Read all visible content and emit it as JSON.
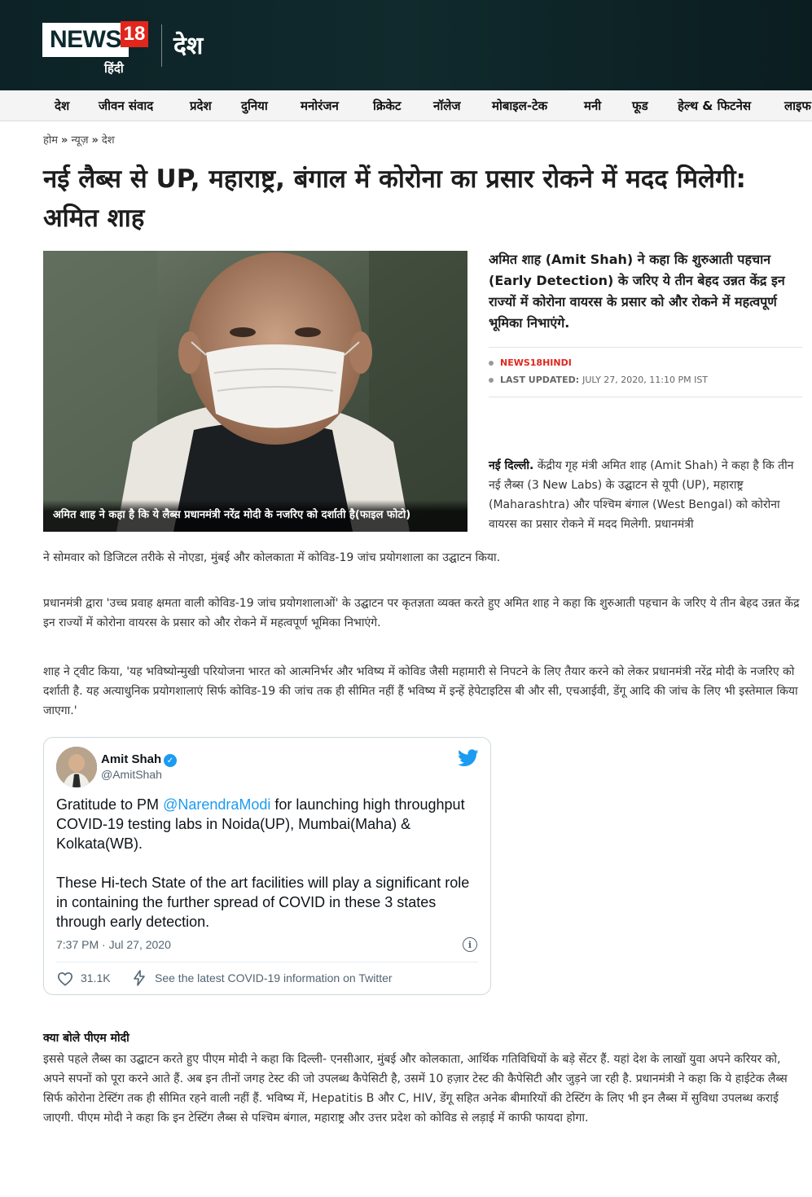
{
  "header": {
    "logo_text": "NEWS",
    "logo_number": "18",
    "logo_sub": "हिंदी",
    "section": "देश"
  },
  "nav": {
    "items": [
      "देश",
      "जीवन संवाद",
      "प्रदेश",
      "दुनिया",
      "मनोरंजन",
      "क्रिकेट",
      "नॉलेज",
      "मोबाइल-टेक",
      "मनी",
      "फूड",
      "हेल्थ & फिटनेस",
      "लाइफ"
    ]
  },
  "breadcrumb": {
    "home": "होम",
    "news": "न्यूज़",
    "section": "देश",
    "separator": "»"
  },
  "article": {
    "title": "नई लैब्स से UP, महाराष्ट्र, बंगाल में कोरोना का प्रसार रोकने में मदद मिलेगी: अमित शाह",
    "image_caption": "अमित शाह ने कहा है कि ये लैब्स प्रधानमंत्री नरेंद्र मोदी के नजरिए को दर्शाती है(फाइल फोटो)",
    "summary": "अमित शाह (Amit Shah) ने कहा कि शुरुआती पहचान (Early Detection) के जरिए ये तीन बेहद उन्नत केंद्र इन राज्यों में कोरोना वायरस के प्रसार को और रोकने में महत्वपूर्ण भूमिका निभाएंगे.",
    "author": "NEWS18HINDI",
    "updated_label": "LAST UPDATED:",
    "updated_value": "JULY 27, 2020, 11:10 PM IST",
    "intro_lead": "नई दिल्ली.",
    "intro_text": " केंद्रीय गृह मंत्री अमित शाह (Amit Shah) ने कहा है कि तीन नई लैब्स (3 New Labs) के उद्घाटन से यूपी (UP), महाराष्ट्र (Maharashtra) और पश्चिम बंगाल (West Bengal) को कोरोना वायरस का प्रसार रोकने में मदद मिलेगी. प्रधानमंत्री",
    "intro_continued": "ने सोमवार को डिजिटल तरीके से नोएडा, मुंबई और कोलकाता में कोविड-19 जांच प्रयोगशाला का उद्घाटन किया.",
    "para2": "प्रधानमंत्री द्वारा 'उच्च प्रवाह क्षमता वाली कोविड-19 जांच प्रयोगशालाओं' के उद्घाटन पर कृतज्ञता व्यक्त करते हुए अमित शाह ने कहा कि शुरुआती पहचान के जरिए ये तीन बेहद उन्नत केंद्र इन राज्यों में कोरोना वायरस के प्रसार को और रोकने में महत्वपूर्ण भूमिका निभाएंगे.",
    "para3": "शाह ने ट्वीट किया, 'यह भविष्योन्मुखी परियोजना भारत को आत्मनिर्भर और भविष्य में कोविड जैसी महामारी से निपटने के लिए तैयार करने को लेकर प्रधानमंत्री नरेंद्र मोदी के नजरिए को दर्शाती है. यह अत्याधुनिक प्रयोगशालाएं सिर्फ कोविड-19 की जांच तक ही सीमित नहीं हैं भविष्य में इन्हें हेपेटाइटिस बी और सी, एचआईवी, डेंगू आदि की जांच के लिए भी इस्तेमाल किया जाएगा.'",
    "subhead": "क्या बोले पीएम मोदी",
    "para4": "इससे पहले लैब्स का उद्घाटन करते हुए पीएम मोदी ने कहा कि दिल्ली- एनसीआर, मुंबई और कोलकाता, आर्थिक गतिविधियों के बड़े सेंटर हैं. यहां देश के लाखों युवा अपने करियर को, अपने सपनों को पूरा करने आते हैं. अब इन तीनों जगह टेस्ट की जो उपलब्ध कैपेसिटी है, उसमें 10 हज़ार टेस्ट की कैपेसिटी और जुड़ने जा रही है. प्रधानमंत्री ने कहा कि ये हाईटेक लैब्स सिर्फ कोरोना टेस्टिंग तक ही सीमित रहने वाली नहीं हैं. भविष्य में, Hepatitis B और C, HIV, डेंगू सहित अनेक बीमारियों की टेस्टिंग के लिए भी इन लैब्स में सुविधा उपलब्ध कराई जाएगी. पीएम मोदी ने कहा कि इन टेस्टिंग लैब्स से पश्चिम बंगाल, महाराष्ट्र और उत्तर प्रदेश को कोविड से लड़ाई में काफी फायदा होगा."
  },
  "tweet": {
    "name": "Amit Shah",
    "handle": "@AmitShah",
    "text1_before": "Gratitude to PM ",
    "mention": "@NarendraModi",
    "text1_after": " for launching high throughput COVID-19 testing labs in Noida(UP), Mumbai(Maha) & Kolkata(WB).",
    "text2": "These Hi-tech State of the art facilities will play a significant role in containing the further spread of COVID in these 3 states through early detection.",
    "time": "7:37 PM · Jul 27, 2020",
    "likes": "31.1K",
    "covid_link": "See the latest COVID-19 information on Twitter"
  },
  "colors": {
    "header_bg": "#0c2226",
    "brand_red": "#e1261c",
    "twitter_blue": "#1d9bf0"
  },
  "icons": [
    "news18-logo",
    "twitter-bird-icon",
    "verified-icon",
    "info-icon",
    "heart-icon",
    "bolt-icon"
  ]
}
